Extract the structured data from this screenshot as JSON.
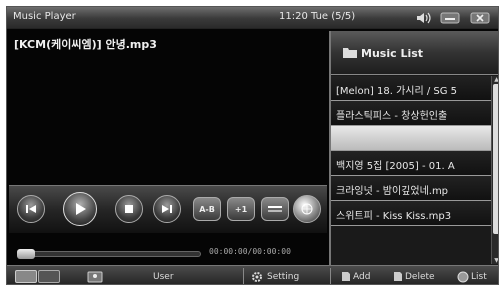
{
  "titlebar": {
    "title": "Music Player",
    "clock": "11:20 Tue (5/5)"
  },
  "player": {
    "now_playing": "[KCM(케이씨엠)] 안녕.mp3",
    "time_readout": "00:00:00/00:00:00",
    "progress": 0.05,
    "controls": {
      "ab_label": "A-B",
      "repeat_label": "+1"
    }
  },
  "bottombar": {
    "user_label": "User",
    "settings_label": "Setting",
    "add_label": "Add",
    "delete_label": "Delete",
    "list_label": "List"
  },
  "playlist": {
    "title": "Music List",
    "tracks": [
      "[Melon] 18. 가시리 / SG 5",
      "플라스틱피스 - 창상헌인출",
      "",
      "백지영 5집 [2005] - 01. A",
      "크라잉넛 - 밤이깊었네.mp",
      "스위트피 - Kiss Kiss.mp3"
    ],
    "selected_index": 2
  },
  "colors": {
    "background": "#050505",
    "panel": "#1a1a1a",
    "selected_row": "#d8d8d8"
  }
}
